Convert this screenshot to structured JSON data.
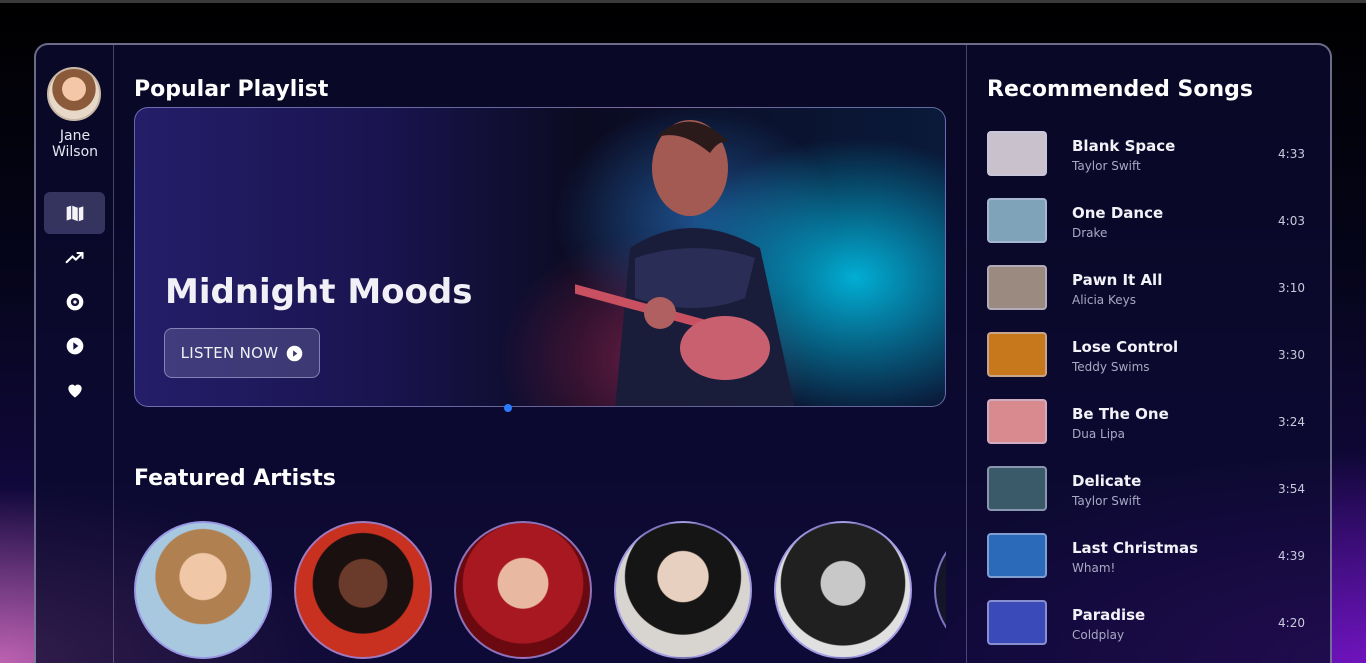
{
  "user": {
    "name": "Jane Wilson"
  },
  "nav": [
    {
      "icon": "map-icon",
      "active": true
    },
    {
      "icon": "trending-icon",
      "active": false
    },
    {
      "icon": "disc-icon",
      "active": false
    },
    {
      "icon": "play-circle-icon",
      "active": false
    },
    {
      "icon": "heart-icon",
      "active": false
    }
  ],
  "main": {
    "playlist_heading": "Popular Playlist",
    "hero": {
      "title": "Midnight Moods",
      "button_label": "LISTEN NOW"
    },
    "artists_heading": "Featured Artists"
  },
  "recommended": {
    "heading": "Recommended Songs",
    "songs": [
      {
        "title": "Blank Space",
        "artist": "Taylor Swift",
        "duration": "4:33",
        "color": "#c9c2cc"
      },
      {
        "title": "One Dance",
        "artist": "Drake",
        "duration": "4:03",
        "color": "#7fa3b8"
      },
      {
        "title": "Pawn It All",
        "artist": "Alicia Keys",
        "duration": "3:10",
        "color": "#9a8a80"
      },
      {
        "title": "Lose Control",
        "artist": "Teddy Swims",
        "duration": "3:30",
        "color": "#c8781c"
      },
      {
        "title": "Be The One",
        "artist": "Dua Lipa",
        "duration": "3:24",
        "color": "#d98a8e"
      },
      {
        "title": "Delicate",
        "artist": "Taylor Swift",
        "duration": "3:54",
        "color": "#3a5a6a"
      },
      {
        "title": "Last Christmas",
        "artist": "Wham!",
        "duration": "4:39",
        "color": "#2a6ab8"
      },
      {
        "title": "Paradise",
        "artist": "Coldplay",
        "duration": "4:20",
        "color": "#3a4ab8"
      }
    ]
  },
  "colors": {
    "accent": "#2a7cff",
    "panel": "#0c0a30"
  }
}
